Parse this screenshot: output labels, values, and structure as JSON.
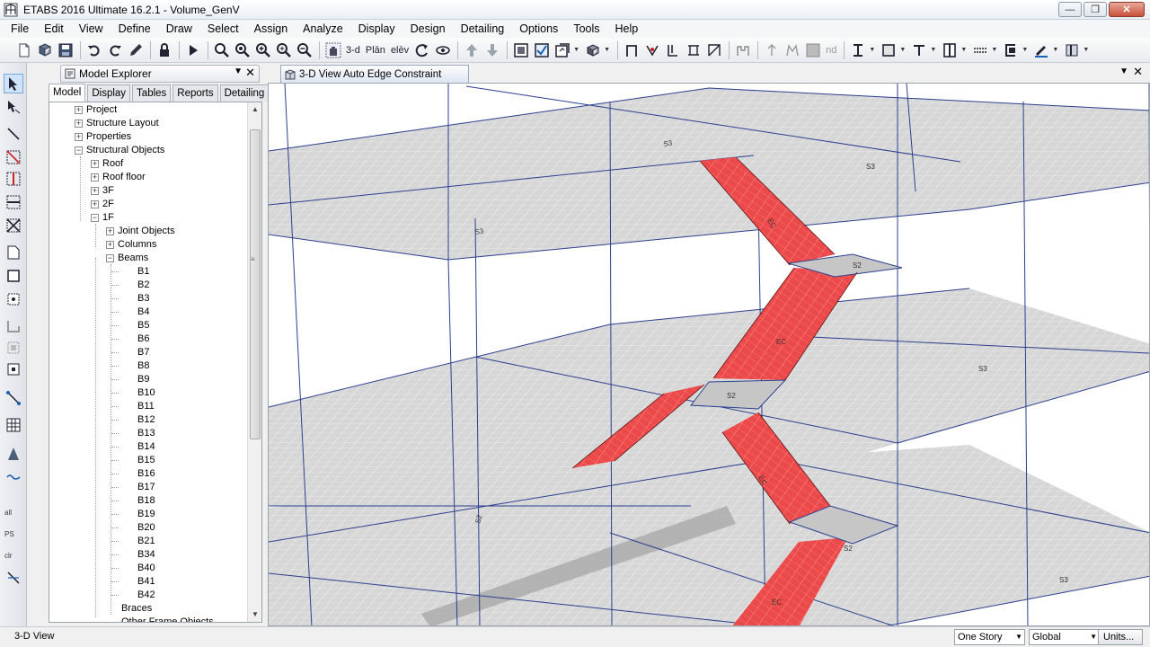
{
  "window": {
    "title": "ETABS 2016 Ultimate 16.2.1 - Volume_GenV",
    "controls": [
      "minimize",
      "restore",
      "close"
    ]
  },
  "menu": [
    "File",
    "Edit",
    "View",
    "Define",
    "Draw",
    "Select",
    "Assign",
    "Analyze",
    "Display",
    "Design",
    "Detailing",
    "Options",
    "Tools",
    "Help"
  ],
  "toolbar": {
    "text_buttons": {
      "three_d": "3-d",
      "plan": "Plān",
      "elev": "elēv",
      "nd": "nd"
    }
  },
  "left_toolbar": {
    "labels": {
      "all": "all",
      "ps": "PS",
      "clr": "clr"
    }
  },
  "explorer": {
    "title": "Model Explorer",
    "tabs": [
      "Model",
      "Display",
      "Tables",
      "Reports",
      "Detailing"
    ],
    "active_tab": "Model",
    "tree": {
      "project": "Project",
      "structure_layout": "Structure Layout",
      "properties": "Properties",
      "structural_objects": "Structural Objects",
      "stories": [
        "Roof",
        "Roof floor",
        "3F",
        "2F"
      ],
      "story_1f": "1F",
      "joint_objects": "Joint Objects",
      "columns": "Columns",
      "beams": "Beams",
      "beam_list": [
        "B1",
        "B2",
        "B3",
        "B4",
        "B5",
        "B6",
        "B7",
        "B8",
        "B9",
        "B10",
        "B11",
        "B12",
        "B13",
        "B14",
        "B15",
        "B16",
        "B17",
        "B18",
        "B19",
        "B20",
        "B21",
        "B34",
        "B40",
        "B41",
        "B42"
      ],
      "braces": "Braces",
      "truncated": "Other Frame Objects"
    }
  },
  "view": {
    "tab_title": "3-D View  Auto Edge Constraint",
    "slab_labels": {
      "ramp": "EC",
      "slab": "S2",
      "slab_alt": "S3"
    }
  },
  "status": {
    "left_text": "3-D View",
    "story_option": "One Story",
    "coord_system": "Global",
    "units_button": "Units..."
  },
  "colors": {
    "ramp_fill": "#ec4a4a",
    "slab_fill": "#d3d3d3",
    "grid_line": "#2b3f8f",
    "active_highlight": "#cfe3fb"
  }
}
